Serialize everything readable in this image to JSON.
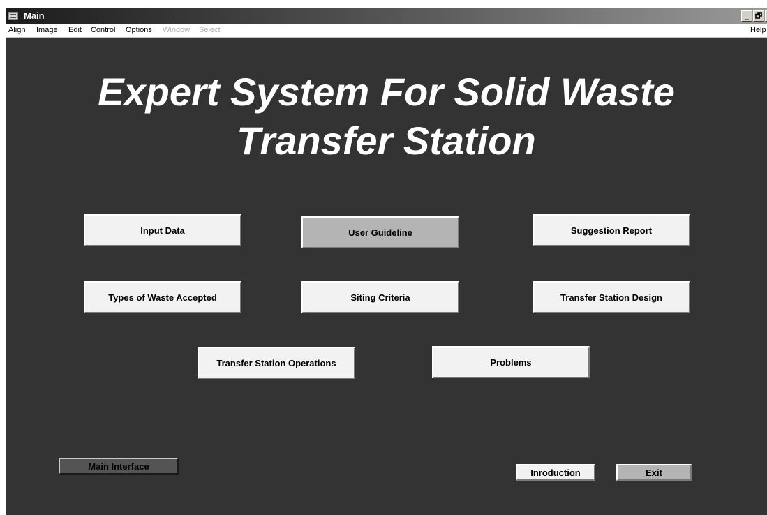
{
  "window": {
    "title": "Main",
    "controls": {
      "minimize": "_",
      "restore": "🗗",
      "close": "x"
    }
  },
  "menubar": {
    "items": [
      {
        "label": "Align",
        "enabled": true
      },
      {
        "label": "Image",
        "enabled": true
      },
      {
        "label": "Edit",
        "enabled": true
      },
      {
        "label": "Control",
        "enabled": true
      },
      {
        "label": "Options",
        "enabled": true
      },
      {
        "label": "Window",
        "enabled": false
      },
      {
        "label": "Select",
        "enabled": false
      }
    ],
    "help": "Help"
  },
  "heading": {
    "line1": "Expert System For  Solid Waste",
    "line2": "Transfer Station"
  },
  "buttons": {
    "input_data": "Input Data",
    "user_guideline": "User Guideline",
    "suggestion_report": "Suggestion Report",
    "types_of_waste": "Types of  Waste Accepted",
    "siting_criteria": "Siting Criteria",
    "station_design": "Transfer Station Design",
    "station_operations": "Transfer Station Operations",
    "problems": "Problems",
    "main_interface": "Main Interface",
    "introduction": "Inroduction",
    "exit": "Exit"
  },
  "colors": {
    "background": "#333333",
    "button_face": "#f2f2f2",
    "button_pressed": "#b4b4b4",
    "button_dark": "#545454",
    "heading_text": "#ffffff"
  }
}
